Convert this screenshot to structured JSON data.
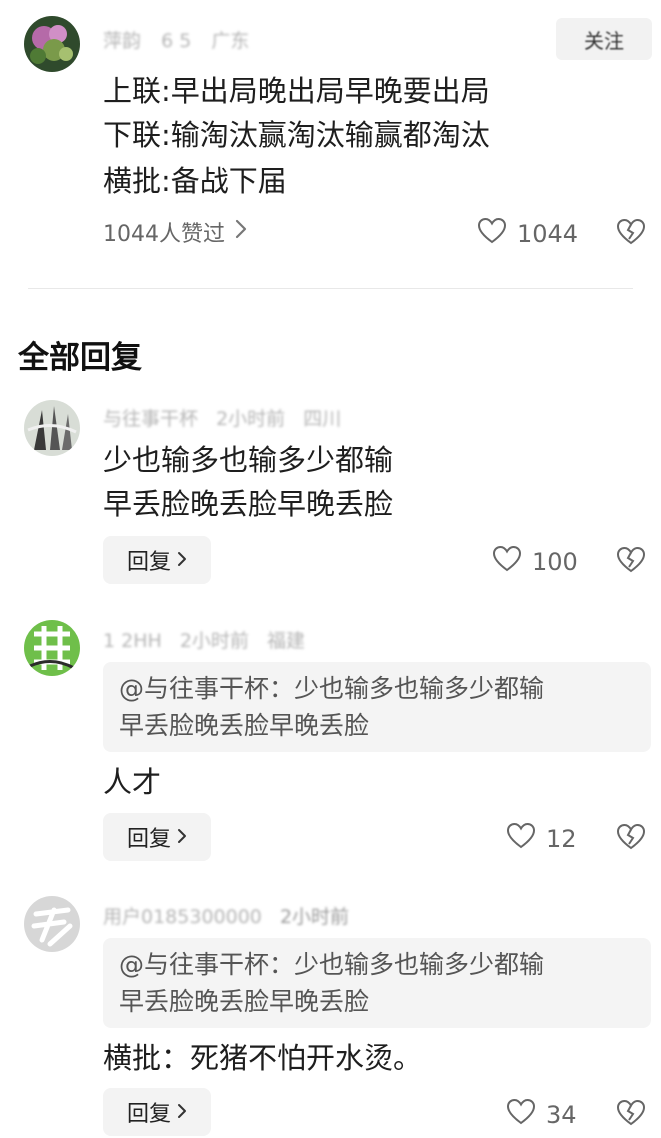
{
  "top_comment": {
    "user": "萍韵",
    "level": "6 5",
    "location": "广东",
    "follow_label": "关注",
    "lines": [
      "上联:早出局晚出局早晚要出局",
      "下联:输淘汰赢淘汰输赢都淘汰",
      "横批:备战下届"
    ],
    "likes_summary": "1044人赞过",
    "like_count": "1044"
  },
  "section_title": "全部回复",
  "replies": [
    {
      "user": "与往事干杯",
      "time": "2小时前",
      "location": "四川",
      "lines": [
        "少也输多也输多少都输",
        "早丢脸晚丢脸早晚丢脸"
      ],
      "reply_label": "回复",
      "like_count": "100"
    },
    {
      "user": "1 2HH",
      "time": "2小时前",
      "location": "福建",
      "quote": [
        "@与往事干杯：少也输多也输多少都输",
        "早丢脸晚丢脸早晚丢脸"
      ],
      "lines": [
        "人才"
      ],
      "reply_label": "回复",
      "like_count": "12"
    },
    {
      "user": "用户0185300000",
      "time": "2小时前",
      "quote": [
        "@与往事干杯：少也输多也输多少都输",
        "早丢脸晚丢脸早晚丢脸"
      ],
      "lines": [
        "横批：死猪不怕开水烫。"
      ],
      "reply_label": "回复",
      "like_count": "34"
    }
  ],
  "icons": {
    "like": "heart-outline-icon",
    "dislike": "broken-heart-icon",
    "chevron": "chevron-right-icon"
  },
  "colors": {
    "text": "#1e1e1e",
    "meta": "#b5b5b5",
    "quote_bg": "#f4f4f4",
    "button_bg": "#f3f3f3"
  }
}
